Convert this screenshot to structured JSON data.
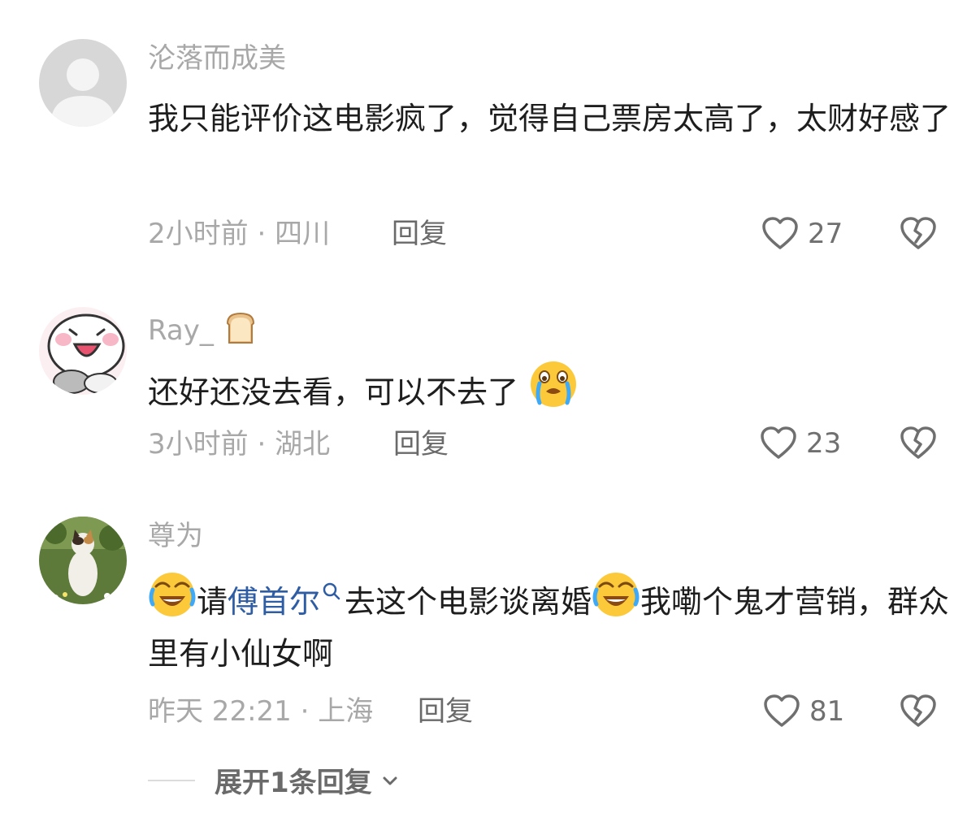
{
  "comments": [
    {
      "username": "沦落而成美",
      "text": "我只能评价这电影疯了，觉得自己票房太高了，太财好感了",
      "time": "2小时前",
      "location": "四川",
      "reply_label": "回复",
      "likes": "27",
      "avatar_icon": "default-user-avatar"
    },
    {
      "username": "Ray_",
      "username_emoji": "bread-emoji",
      "text": "还好还没去看，可以不去了",
      "text_emoji": "crying-face-emoji",
      "time": "3小时前",
      "location": "湖北",
      "reply_label": "回复",
      "likes": "23",
      "avatar_icon": "pink-cartoon-avatar"
    },
    {
      "username": "尊为",
      "text_part1": "请",
      "mention": "傅首尔",
      "text_part2": "去这个电影谈离婚",
      "text_part3": "我嘞个鬼才营销，群众里有小仙女啊",
      "text_emoji": "laughing-crying-emoji",
      "time": "昨天 22:21",
      "location": "上海",
      "reply_label": "回复",
      "likes": "81",
      "avatar_icon": "cat-photo-avatar"
    }
  ],
  "expand_replies": "展开1条回复",
  "colors": {
    "secondary_text": "#a8a8a8",
    "primary_text": "#1e1e1e",
    "mention": "#2f5da3"
  }
}
